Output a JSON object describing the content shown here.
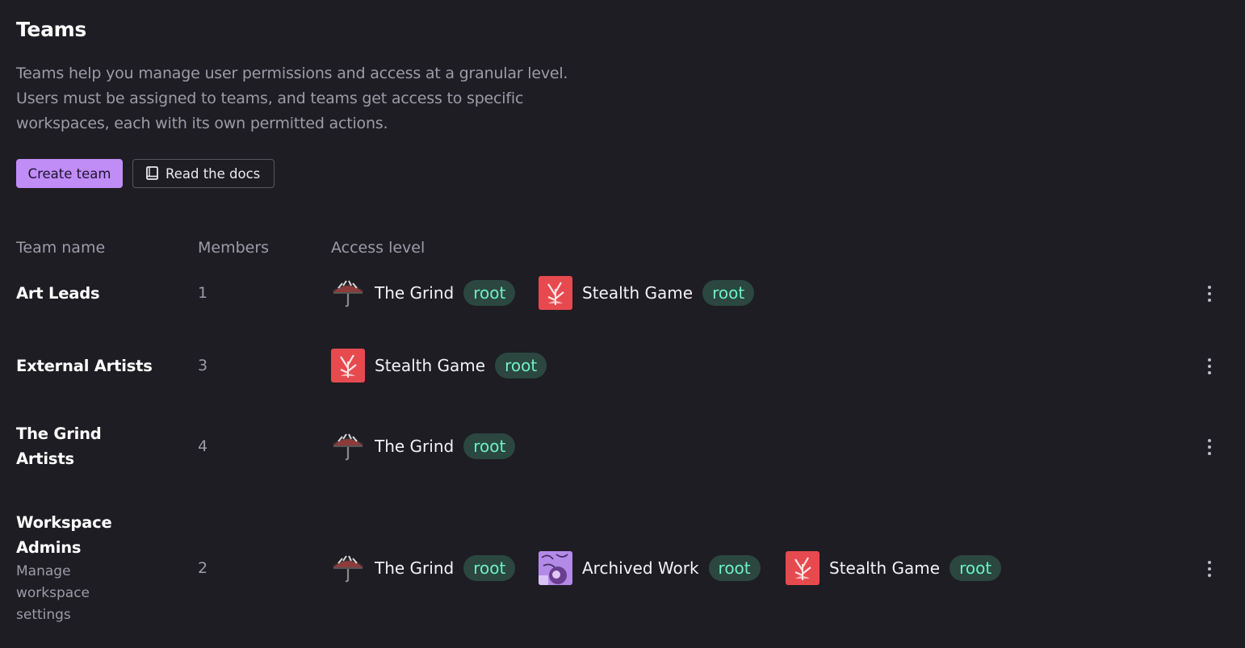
{
  "header": {
    "title": "Teams",
    "description_lines": [
      "Teams help you manage user permissions and access at a granular level.",
      "Users must be assigned to teams, and teams get access to specific",
      "workspaces, each with its own permitted actions."
    ]
  },
  "actions": {
    "create_label": "Create team",
    "docs_label": "Read the docs"
  },
  "table": {
    "columns": [
      "Team name",
      "Members",
      "Access level"
    ],
    "rows": [
      {
        "name_lines": [
          "Art Leads"
        ],
        "description_lines": [],
        "members": "1",
        "access": [
          {
            "workspace": "The Grind",
            "level": "root",
            "icon": "umbrella-icon"
          },
          {
            "workspace": "Stealth Game",
            "level": "root",
            "icon": "plant-icon"
          }
        ]
      },
      {
        "name_lines": [
          "External Artists"
        ],
        "description_lines": [],
        "members": "3",
        "access": [
          {
            "workspace": "Stealth Game",
            "level": "root",
            "icon": "plant-icon"
          }
        ]
      },
      {
        "name_lines": [
          "The Grind",
          "Artists"
        ],
        "description_lines": [],
        "members": "4",
        "access": [
          {
            "workspace": "The Grind",
            "level": "root",
            "icon": "umbrella-icon"
          }
        ]
      },
      {
        "name_lines": [
          "Workspace",
          "Admins"
        ],
        "description_lines": [
          "Manage",
          "workspace",
          "settings"
        ],
        "members": "2",
        "access": [
          {
            "workspace": "The Grind",
            "level": "root",
            "icon": "umbrella-icon"
          },
          {
            "workspace": "Archived Work",
            "level": "root",
            "icon": "abstract-art-icon"
          },
          {
            "workspace": "Stealth Game",
            "level": "root",
            "icon": "plant-icon"
          }
        ]
      }
    ]
  },
  "colors": {
    "background": "#1e1d23",
    "accent": "#c08cf6",
    "badge_bg": "#2b4740",
    "badge_text": "#6ff0c5",
    "stealth_icon_bg": "#e64a4f",
    "archived_icon_bg": "#b38ae8"
  }
}
